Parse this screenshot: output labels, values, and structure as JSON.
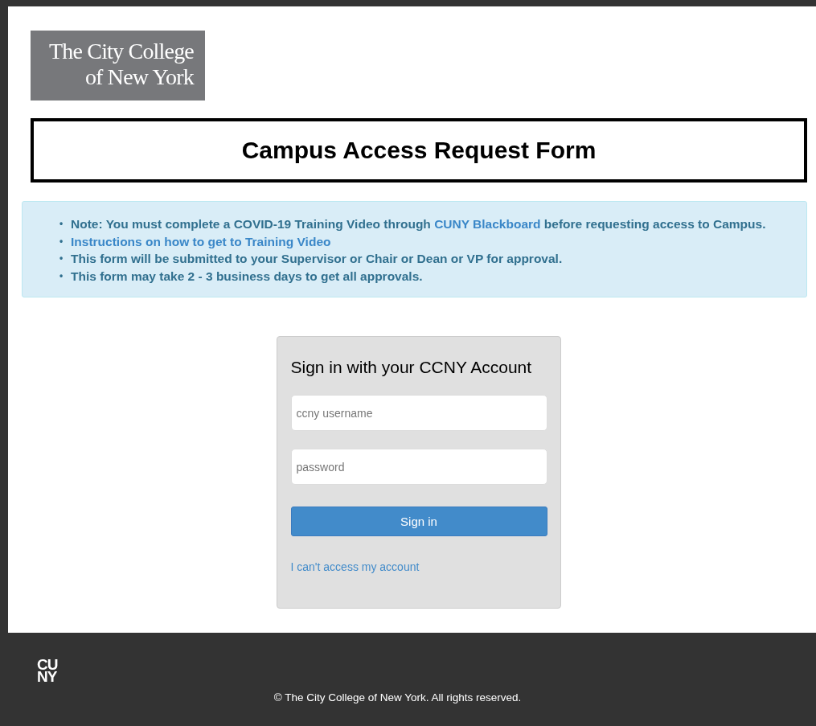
{
  "logo": {
    "lines": [
      "The City College",
      "of New York"
    ]
  },
  "title": "Campus Access Request Form",
  "notices": [
    {
      "bullet": "•",
      "parts": [
        {
          "kind": "text",
          "text": "Note: You must complete a COVID-19 Training Video through "
        },
        {
          "kind": "link",
          "text": "CUNY Blackboard"
        },
        {
          "kind": "text",
          "text": " before requesting access to Campus."
        }
      ]
    },
    {
      "bullet": "•",
      "parts": [
        {
          "kind": "link",
          "text": "Instructions on how to get to Training Video"
        }
      ]
    },
    {
      "bullet": "•",
      "parts": [
        {
          "kind": "text",
          "text": "This form will be submitted to your Supervisor or Chair or Dean or VP for approval."
        }
      ]
    },
    {
      "bullet": "•",
      "parts": [
        {
          "kind": "text",
          "text": "This form may take 2 - 3 business days to get all approvals."
        }
      ]
    }
  ],
  "login": {
    "heading": "Sign in with your CCNY Account",
    "fields": [
      {
        "placeholder": "ccny username"
      },
      {
        "placeholder": "password"
      }
    ],
    "button": "Sign in",
    "help_link": "I can't access my account"
  },
  "footer": {
    "logo_lines": [
      "CU",
      "NY"
    ],
    "copyright": "© The City College of New York. All rights reserved."
  }
}
